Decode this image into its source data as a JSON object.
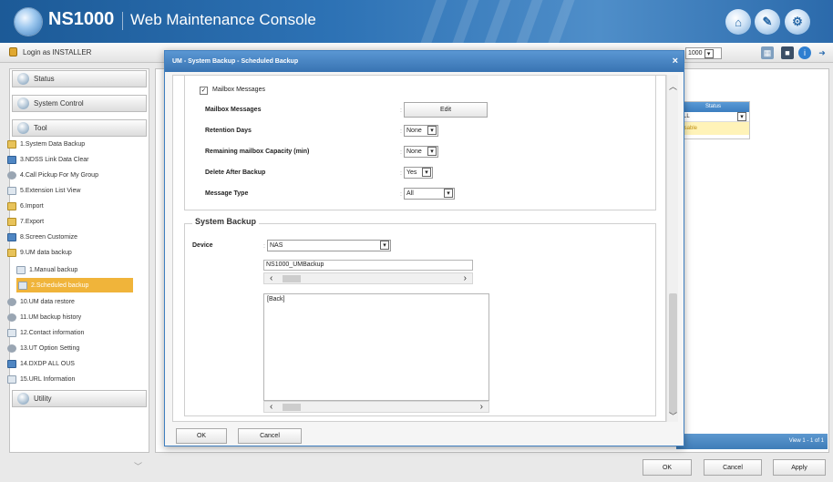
{
  "header": {
    "brand": "NS1000",
    "subtitle": "Web Maintenance Console",
    "icons": [
      "home-icon",
      "tool-icon",
      "gear-icon"
    ]
  },
  "toolbar": {
    "login_text": "Login as INSTALLER",
    "unit_select": "1000",
    "icons": [
      "table-icon",
      "save-icon",
      "info-icon",
      "exit-icon"
    ]
  },
  "sidebar": {
    "sections": [
      {
        "label": "Status"
      },
      {
        "label": "System Control"
      },
      {
        "label": "Tool"
      },
      {
        "label": "Utility"
      }
    ],
    "items": [
      {
        "label": "1.System Data Backup",
        "icon": "folder"
      },
      {
        "label": "3.NDSS Link Data Clear",
        "icon": "blue"
      },
      {
        "label": "4.Call Pickup For My Group",
        "icon": "gear"
      },
      {
        "label": "5.Extension List View",
        "icon": "doc"
      },
      {
        "label": "6.Import",
        "icon": "folder"
      },
      {
        "label": "7.Export",
        "icon": "folder"
      },
      {
        "label": "8.Screen Customize",
        "icon": "blue"
      },
      {
        "label": "9.UM data backup",
        "icon": "folder"
      },
      {
        "label": "1.Manual backup",
        "icon": "doc",
        "sub": true
      },
      {
        "label": "2.Scheduled backup",
        "icon": "doc",
        "sub": true,
        "active": true
      },
      {
        "label": "10.UM data restore",
        "icon": "gear"
      },
      {
        "label": "11.UM backup history",
        "icon": "gear"
      },
      {
        "label": "12.Contact information",
        "icon": "doc"
      },
      {
        "label": "13.UT Option Setting",
        "icon": "gear"
      },
      {
        "label": "14.DXDP ALL OUS",
        "icon": "blue"
      },
      {
        "label": "15.URL Information",
        "icon": "doc"
      }
    ]
  },
  "background": {
    "status_header": "Status",
    "status_select": "ALL",
    "status_value": "Disable",
    "view_text": "View 1 - 1 of 1",
    "buttons": {
      "ok": "OK",
      "cancel": "Cancel",
      "apply": "Apply"
    }
  },
  "modal": {
    "title": "UM - System Backup - Scheduled Backup",
    "close": "×",
    "mailbox_checkbox": {
      "label": "Mailbox Messages",
      "checked": true,
      "mark": "✓"
    },
    "mailbox_messages": {
      "label": "Mailbox Messages",
      "button": "Edit"
    },
    "retention_days": {
      "label": "Retention Days",
      "value": "None"
    },
    "remaining_capacity": {
      "label": "Remaining mailbox Capacity (min)",
      "value": "None"
    },
    "delete_after": {
      "label": "Delete After Backup",
      "value": "Yes"
    },
    "message_type": {
      "label": "Message Type",
      "value": "All"
    },
    "system_backup": {
      "title": "System Backup",
      "device_label": "Device",
      "device_value": "NAS",
      "path": "NS1000_UMBackup",
      "list_items": [
        "[Back]"
      ]
    },
    "buttons": {
      "ok": "OK",
      "cancel": "Cancel"
    }
  }
}
